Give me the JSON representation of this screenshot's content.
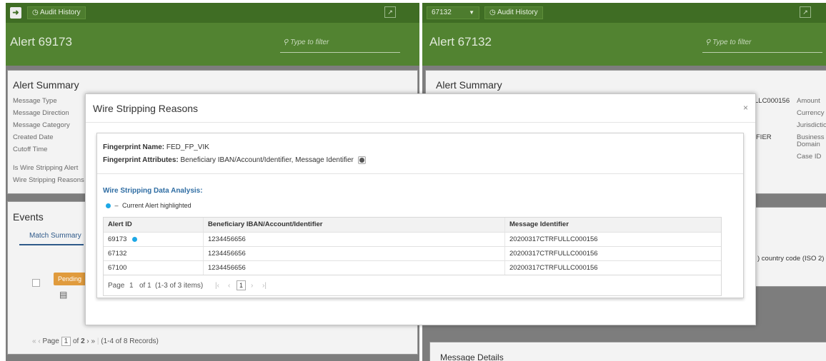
{
  "left_pane": {
    "audit_history_label": "Audit History",
    "alert_title": "Alert 69173",
    "filter_placeholder": "Type to filter",
    "alert_summary_title": "Alert Summary",
    "summary_fields": [
      "Message Type",
      "Message Direction",
      "Message Category",
      "Created Date",
      "Cutoff Time",
      "Is Wire Stripping Alert",
      "Wire Stripping Reasons"
    ],
    "events_title": "Events",
    "match_summary_tab": "Match Summary",
    "pending_badge": "Pending",
    "pager": {
      "page_label": "Page",
      "page_value": "1",
      "of_label": "of",
      "total_pages": "2",
      "records": "(1-4 of 8 Records)"
    }
  },
  "right_pane": {
    "alert_selector": "67132",
    "audit_history_label": "Audit History",
    "alert_title": "Alert 67132",
    "filter_placeholder": "Type to filter",
    "alert_summary_title": "Alert Summary",
    "partial_ref": "LLC000156",
    "partial_identifier": "FIER",
    "summary_right_fields": [
      "Amount",
      "Currency",
      "Jurisdictio",
      "Business",
      "Domain",
      "Case ID"
    ],
    "country_code_text": ") country code (ISO 2)",
    "message_details_title": "Message Details"
  },
  "modal": {
    "title": "Wire Stripping Reasons",
    "close": "×",
    "fingerprint_name_label": "Fingerprint Name:",
    "fingerprint_name_value": "FED_FP_VIK",
    "fingerprint_attributes_label": "Fingerprint Attributes:",
    "fingerprint_attributes_value": "Beneficiary IBAN/Account/Identifier, Message Identifier",
    "analysis_title": "Wire Stripping Data Analysis:",
    "legend_dash": "–",
    "legend_text": "Current Alert highlighted",
    "grid": {
      "headers": [
        "Alert ID",
        "Beneficiary IBAN/Account/Identifier",
        "Message Identifier"
      ],
      "rows": [
        {
          "alert_id": "69173",
          "beneficiary": "1234456656",
          "message_id": "20200317CTRFULLC000156",
          "current": true
        },
        {
          "alert_id": "67132",
          "beneficiary": "1234456656",
          "message_id": "20200317CTRFULLC000156",
          "current": false
        },
        {
          "alert_id": "67100",
          "beneficiary": "1234456656",
          "message_id": "20200317CTRFULLC000156",
          "current": false
        }
      ],
      "pager": {
        "page_label": "Page",
        "page_value": "1",
        "of_text": "of 1",
        "items_text": "(1-3 of 3 items)",
        "current_page": "1"
      }
    }
  },
  "colors": {
    "header_dark_green": "#3f6d24",
    "header_green": "#528331",
    "overlay_gray": "#7d7d7d",
    "current_dot": "#1ea8e6",
    "link_blue": "#2f6da3"
  }
}
